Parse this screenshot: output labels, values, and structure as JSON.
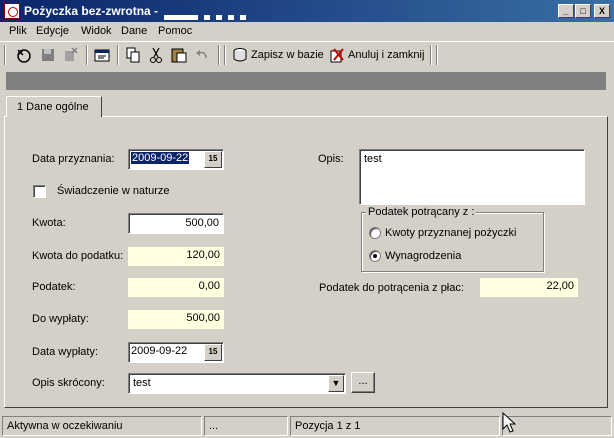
{
  "window": {
    "title": "Pożyczka bez-zwrotna -",
    "minimize_glyph": "_",
    "maximize_glyph": "□",
    "close_glyph": "X"
  },
  "menu": [
    "Plik",
    "Edycje",
    "Widok",
    "Dane",
    "Pomoc"
  ],
  "toolbar": {
    "save_db_label": "Zapisz w bazie",
    "cancel_close_label": "Anuluj i zamknij"
  },
  "tabs": [
    {
      "label": "1 Dane ogólne"
    }
  ],
  "form": {
    "data_przyznania": {
      "label": "Data przyznania:",
      "value": "2009-09-22"
    },
    "swiadczenie": {
      "label": "Świadczenie w naturze",
      "checked": false
    },
    "kwota": {
      "label": "Kwota:",
      "value": "500,00"
    },
    "kwota_do_podatku": {
      "label": "Kwota do podatku:",
      "value": "120,00"
    },
    "podatek": {
      "label": "Podatek:",
      "value": "0,00"
    },
    "do_wyplaty": {
      "label": "Do wypłaty:",
      "value": "500,00"
    },
    "data_wyplaty": {
      "label": "Data wypłaty:",
      "value": "2009-09-22"
    },
    "opis_skrocony": {
      "label": "Opis skrócony:",
      "value": "test",
      "more_label": "..."
    },
    "opis": {
      "label": "Opis:",
      "value": "test"
    },
    "podatek_group": {
      "title": "Podatek potrącany z :",
      "options": [
        "Kwoty przyznanej pożyczki",
        "Wynagrodzenia"
      ],
      "selected": "Wynagrodzenia"
    },
    "podatek_z_plac": {
      "label": "Podatek do potrącenia z płac:",
      "value": "22,00"
    },
    "calendar_glyph": "15",
    "combo_glyph": "▼"
  },
  "status": {
    "state": "Aktywna w oczekiwaniu",
    "middle": "...",
    "position": "Pozycja 1 z 1"
  }
}
